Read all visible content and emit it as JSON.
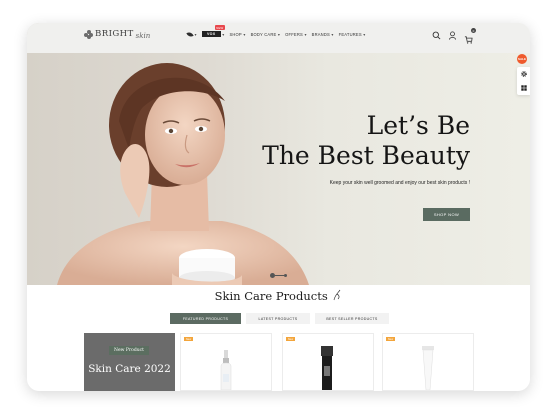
{
  "brand": {
    "name": "BRIGHT",
    "tagline": "skin"
  },
  "nav": {
    "items": [
      {
        "label": "",
        "icon": "leaf-icon"
      },
      {
        "label": "VOX",
        "icon": "brand-logo",
        "badge": "NEW"
      },
      {
        "label": "SHOP"
      },
      {
        "label": "BODY CARE"
      },
      {
        "label": "OFFERS"
      },
      {
        "label": "BRANDS"
      },
      {
        "label": "FEATURES"
      }
    ]
  },
  "header_icons": {
    "search": "search-icon",
    "account": "user-icon",
    "cart": "cart-icon",
    "cart_count": "0"
  },
  "hero": {
    "title_line1": "Let’s Be",
    "title_line2": "The Best Beauty",
    "subtitle": "Keep your skin well groomed and enjoy our best skin products !",
    "button": "SHOP NOW"
  },
  "side_tools": {
    "sale": "SALE",
    "settings_icon": "gear-icon",
    "layout_icon": "grid-icon"
  },
  "section": {
    "title": "Skin Care Products",
    "tabs": [
      "FEATURED PRODUCTS",
      "LATEST PRODUCTS",
      "BEST SELLER PRODUCTS"
    ]
  },
  "promo": {
    "badge": "New Product",
    "title": "Skin Care 2022"
  },
  "products": [
    {
      "tag": "New"
    },
    {
      "tag": "New"
    },
    {
      "tag": "New"
    }
  ],
  "colors": {
    "accent": "#5c6b62",
    "sale": "#f3a53b",
    "hot": "#ef5a2c"
  }
}
